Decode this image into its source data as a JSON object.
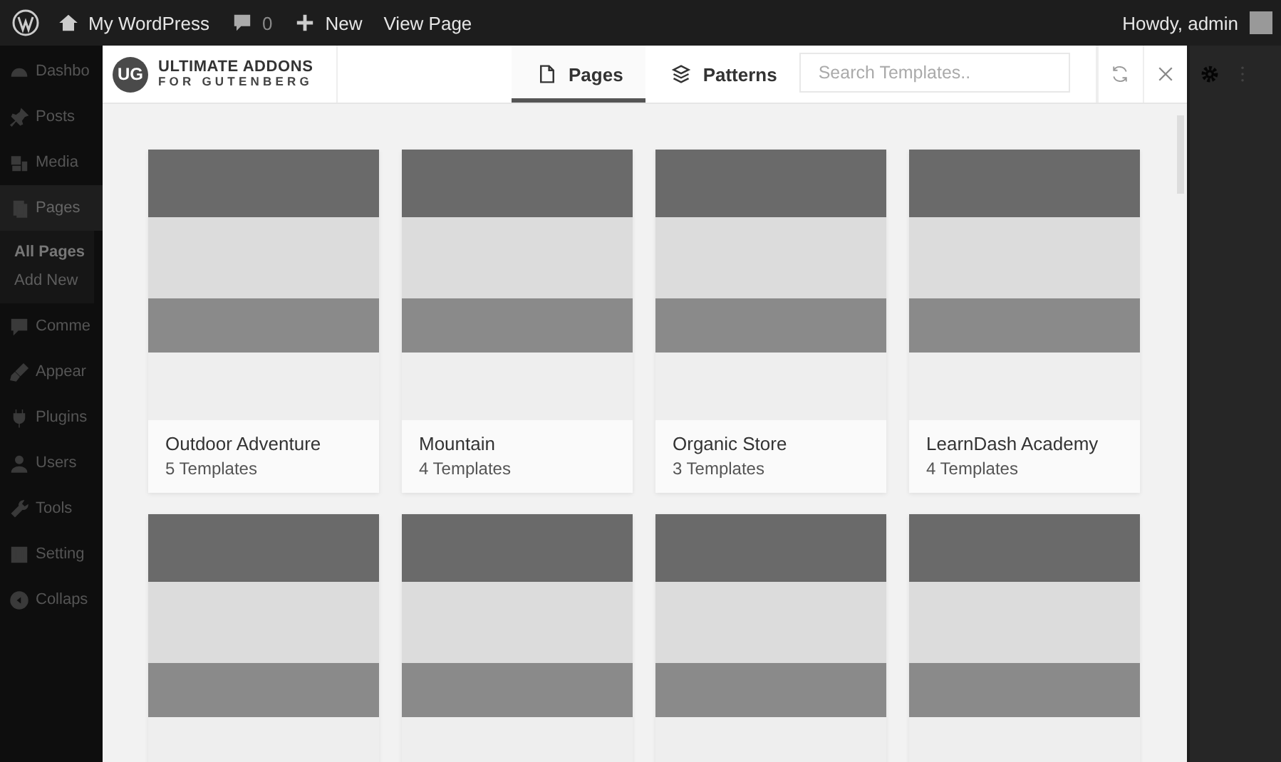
{
  "admin_bar": {
    "site_name": "My WordPress",
    "comments_count": "0",
    "new_label": "New",
    "view_label": "View Page",
    "greeting": "Howdy, admin"
  },
  "sidebar": {
    "items": [
      {
        "label": "Dashbo",
        "selected": false
      },
      {
        "label": "Posts",
        "selected": false
      },
      {
        "label": "Media",
        "selected": false
      },
      {
        "label": "Pages",
        "selected": true,
        "children": [
          {
            "label": "All Pages",
            "selected": true
          },
          {
            "label": "Add New",
            "selected": false
          }
        ]
      },
      {
        "label": "Comme",
        "selected": false
      },
      {
        "label": "Appear",
        "selected": false
      },
      {
        "label": "Plugins",
        "selected": false
      },
      {
        "label": "Users",
        "selected": false
      },
      {
        "label": "Tools",
        "selected": false
      },
      {
        "label": "Setting",
        "selected": false
      },
      {
        "label": "Collaps",
        "selected": false
      }
    ]
  },
  "modal": {
    "logo": {
      "badge": "UG",
      "line_1": "ULTIMATE ADDONS",
      "line_2": "FOR GUTENBERG"
    },
    "tabs": [
      {
        "label": "Pages",
        "selected": true
      },
      {
        "label": "Patterns",
        "selected": false
      }
    ],
    "search": {
      "placeholder": "Search Templates.."
    },
    "cards": [
      {
        "kind": "titled",
        "title": "Outdoor Adventure",
        "count": "5 Templates"
      },
      {
        "kind": "titled",
        "title": "Mountain",
        "count": "4 Templates"
      },
      {
        "kind": "titled",
        "title": "Organic Store",
        "count": "3 Templates"
      },
      {
        "kind": "titled",
        "title": "LearnDash Academy",
        "count": "4 Templates"
      },
      {
        "kind": "preview_only"
      },
      {
        "kind": "preview_only"
      },
      {
        "kind": "preview_only"
      },
      {
        "kind": "preview_only"
      }
    ]
  }
}
